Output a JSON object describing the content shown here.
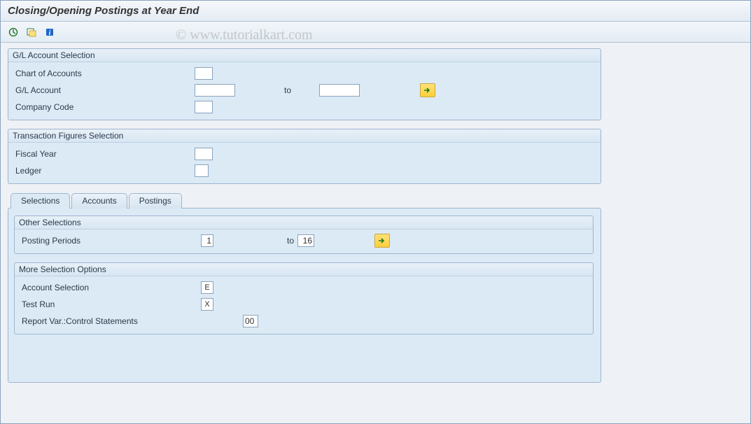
{
  "title": "Closing/Opening Postings at Year End",
  "watermark": "© www.tutorialkart.com",
  "toolbar": {
    "execute": "Execute",
    "variant": "Get Variant",
    "info": "Information"
  },
  "groups": {
    "gl": {
      "title": "G/L Account Selection",
      "chart_of_accounts": "Chart of Accounts",
      "gl_account": "G/L Account",
      "to": "to",
      "company_code": "Company Code",
      "values": {
        "chart": "",
        "gl_from": "",
        "gl_to": "",
        "ccode": ""
      }
    },
    "trans": {
      "title": "Transaction Figures Selection",
      "fiscal_year": "Fiscal Year",
      "ledger": "Ledger",
      "values": {
        "fy": "",
        "ledger": ""
      }
    }
  },
  "tabs": {
    "selections": "Selections",
    "accounts": "Accounts",
    "postings": "Postings"
  },
  "other_selections": {
    "title": "Other Selections",
    "posting_periods": "Posting Periods",
    "to": "to",
    "values": {
      "from": "1",
      "to": "16"
    }
  },
  "more_options": {
    "title": "More Selection Options",
    "account_selection": "Account Selection",
    "test_run": "Test Run",
    "report_var": "Report Var.:Control Statements",
    "values": {
      "acct_sel": "E",
      "test_run": "X",
      "report_var": "00"
    }
  }
}
